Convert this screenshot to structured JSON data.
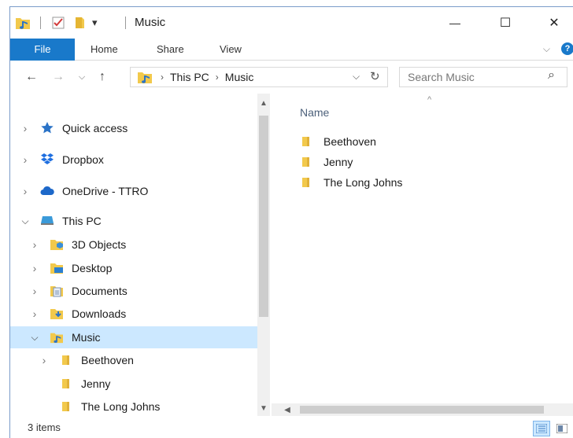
{
  "window": {
    "title": "Music",
    "qa_dropdown_glyph": "▾",
    "minimize_glyph": "—",
    "maximize_glyph": "☐",
    "close_glyph": "✕"
  },
  "ribbon": {
    "tabs": [
      "File",
      "Home",
      "Share",
      "View"
    ],
    "expand_glyph": "⌵",
    "help_glyph": "?"
  },
  "address": {
    "back_glyph": "←",
    "forward_glyph": "→",
    "recent_glyph": "⌵",
    "up_glyph": "↑",
    "breadcrumb": [
      "This PC",
      "Music"
    ],
    "crumb_sep": "›",
    "dropdown_glyph": "⌵",
    "refresh_glyph": "↻",
    "search_placeholder": "Search Music",
    "search_glyph": "⌕"
  },
  "nav": {
    "collapsed_glyph": "›",
    "expanded_glyph": "⌵",
    "items": [
      {
        "label": "Quick access",
        "icon": "star-icon"
      },
      {
        "label": "Dropbox",
        "icon": "dropbox-icon"
      },
      {
        "label": "OneDrive - TTRO",
        "icon": "cloud-icon"
      },
      {
        "label": "This PC",
        "icon": "computer-icon"
      },
      {
        "label": "3D Objects",
        "icon": "cube-folder-icon"
      },
      {
        "label": "Desktop",
        "icon": "desktop-folder-icon"
      },
      {
        "label": "Documents",
        "icon": "documents-folder-icon"
      },
      {
        "label": "Downloads",
        "icon": "downloads-folder-icon"
      },
      {
        "label": "Music",
        "icon": "music-folder-icon"
      },
      {
        "label": "Beethoven",
        "icon": "folder-icon"
      },
      {
        "label": "Jenny",
        "icon": "folder-icon"
      },
      {
        "label": "The Long Johns",
        "icon": "folder-icon"
      }
    ],
    "scroll_up_glyph": "▲",
    "scroll_down_glyph": "▼"
  },
  "content": {
    "column_name": "Name",
    "sort_glyph": "^",
    "files": [
      "Beethoven",
      "Jenny",
      "The Long Johns"
    ],
    "scroll_left_glyph": "◀"
  },
  "status": {
    "item_count": "3 items"
  },
  "colors": {
    "accent": "#1979ca",
    "selection": "#cce8ff",
    "folder": "#f2c94c"
  }
}
